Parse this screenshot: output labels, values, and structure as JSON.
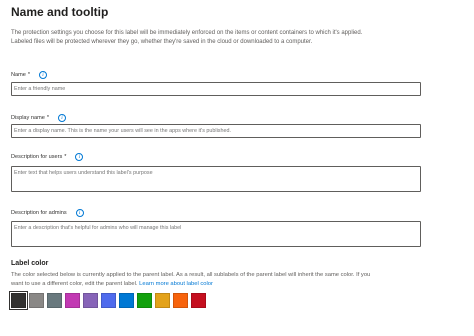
{
  "page": {
    "title": "Name and tooltip",
    "description_line1": "The protection settings you choose for this label will be immediately enforced on the items or content containers to which it's applied.",
    "description_line2": "Labeled files will be protected wherever they go, whether they're saved in the cloud or downloaded to a computer."
  },
  "fields": {
    "name": {
      "label": "Name",
      "required_mark": "*",
      "placeholder": "Enter a friendly name",
      "value": ""
    },
    "display_name": {
      "label": "Display name",
      "required_mark": "*",
      "placeholder": "Enter a display name. This is the name your users will see in the apps where it's published.",
      "value": ""
    },
    "description_users": {
      "label": "Description for users",
      "required_mark": "*",
      "placeholder": "Enter text that helps users understand this label's purpose",
      "value": ""
    },
    "description_admins": {
      "label": "Description for admins",
      "placeholder": "Enter a description that's helpful for admins who will manage this label",
      "value": ""
    }
  },
  "label_color": {
    "heading": "Label color",
    "note_line1": "The color selected below is currently applied to the parent label. As a result, all sublabels of the parent label will inherit the same color. If you",
    "note_line2": "want to use a different color, edit the parent label.",
    "learn_more_link": "Learn more about label color",
    "selected_index": 0,
    "swatches": [
      "#323130",
      "#8a8886",
      "#69797e",
      "#c239b3",
      "#8764b8",
      "#4f6bed",
      "#0078d4",
      "#13a10e",
      "#e3a21a",
      "#f7630c",
      "#c50f1f"
    ]
  },
  "icons": {
    "info": "info-icon"
  },
  "colors": {
    "accent": "#0078d4",
    "border": "#605e5c",
    "text": "#323130"
  }
}
